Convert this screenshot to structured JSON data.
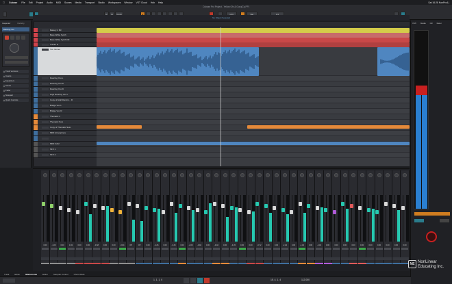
{
  "menubar": {
    "app": "Cubase",
    "items": [
      "File",
      "Edit",
      "Project",
      "Audio",
      "MIDI",
      "Scores",
      "Media",
      "Transport",
      "Studio",
      "Workspaces",
      "Window",
      "VST Cloud",
      "Hub",
      "Help"
    ],
    "clock": "Sat 16:28  NonPro4 |"
  },
  "toolbar": {
    "title": "Cubase Pro Project - Yellow Gfx & Guru(Cp.PP)",
    "touch_label": "Touch",
    "grid_label": "1/16",
    "bar_label": "Bar",
    "quant_label": "1/4"
  },
  "infoline": {
    "text": "No Object Selected"
  },
  "inspector": {
    "tabs": [
      "Inspector",
      "Visibility"
    ],
    "track_label": "Dancing You",
    "rows": [
      "Track Versions",
      "Inserts",
      "Equalizers",
      "Sends",
      "Fader",
      "Notepad",
      "Quick Controls"
    ]
  },
  "tracks": [
    {
      "name": "Battery 4 B3",
      "color": "#d1434b"
    },
    {
      "name": "Bass White Synth",
      "color": "#d1434b"
    },
    {
      "name": "Bass White Synth Fill",
      "color": "#d1434b"
    },
    {
      "name": "Tracks H",
      "color": "#d1434b"
    },
    {
      "name": "Vox Verses",
      "color": "#3f6f9e",
      "selected": true
    },
    {
      "name": "Dancing You L",
      "color": "#3f6f9e"
    },
    {
      "name": "Dancing You R",
      "color": "#3f6f9e"
    },
    {
      "name": "Dancing You Fi",
      "color": "#3f6f9e"
    },
    {
      "name": "High Dancing Vox L",
      "color": "#3f6f9e"
    },
    {
      "name": "Copy of High Dancin... R",
      "color": "#3f6f9e"
    },
    {
      "name": "Bridge Vox L",
      "color": "#3f6f9e"
    },
    {
      "name": "Bridge Vox R",
      "color": "#3f6f9e"
    },
    {
      "name": "Thematic 1",
      "color": "#e58a3a"
    },
    {
      "name": "Thematic Solo",
      "color": "#e58a3a"
    },
    {
      "name": "Copy of Thematic Solo",
      "color": "#e58a3a"
    },
    {
      "name": "MIDI Atmosphere",
      "color": "#3f6f9e"
    },
    {
      "name": "",
      "color": "#3f6f9e"
    },
    {
      "name": "MIDI Fx02",
      "color": "#555"
    },
    {
      "name": "SFX 1",
      "color": "#555"
    },
    {
      "name": "SFX 2",
      "color": "#555"
    }
  ],
  "mixer": {
    "volumes": [
      "0.00",
      "-1.00",
      "0.00",
      "1.82",
      "0.00",
      "0.00",
      "-3.68",
      "0.00",
      "0.00",
      "-0.84",
      "Off",
      "Off",
      "0.00",
      "-4.26",
      "0.00",
      "-3.45",
      "0.00",
      "-2.00",
      "-3.92",
      "0.00",
      "-4.92",
      "0.00",
      "-4.45",
      "0.00",
      "0.00",
      "-0.72",
      "0.00",
      "0.00",
      "-2.23",
      "0.00",
      "-1.34",
      "0.00",
      "-2.43",
      "0.00",
      "0.00",
      "0.00",
      "0.00",
      "0.00",
      "0.00",
      "0.00",
      "0.00",
      "0.00",
      "0.00"
    ]
  },
  "bottomtabs": [
    "Track",
    "Editor",
    "MixConsole",
    "Editor",
    "Sampler Control",
    "Chord Pads"
  ],
  "transport": {
    "position": "1. 1. 1. 0",
    "position2": "15. 4. 1. 4",
    "tempo": "112.000"
  },
  "logo": {
    "line1": "NonLinear",
    "line2": "Educating Inc."
  },
  "colors": {
    "accent": "#d07d20",
    "clip_blue": "#4f86c0",
    "clip_orange": "#e58a3a",
    "meter": "#26c8b0"
  }
}
